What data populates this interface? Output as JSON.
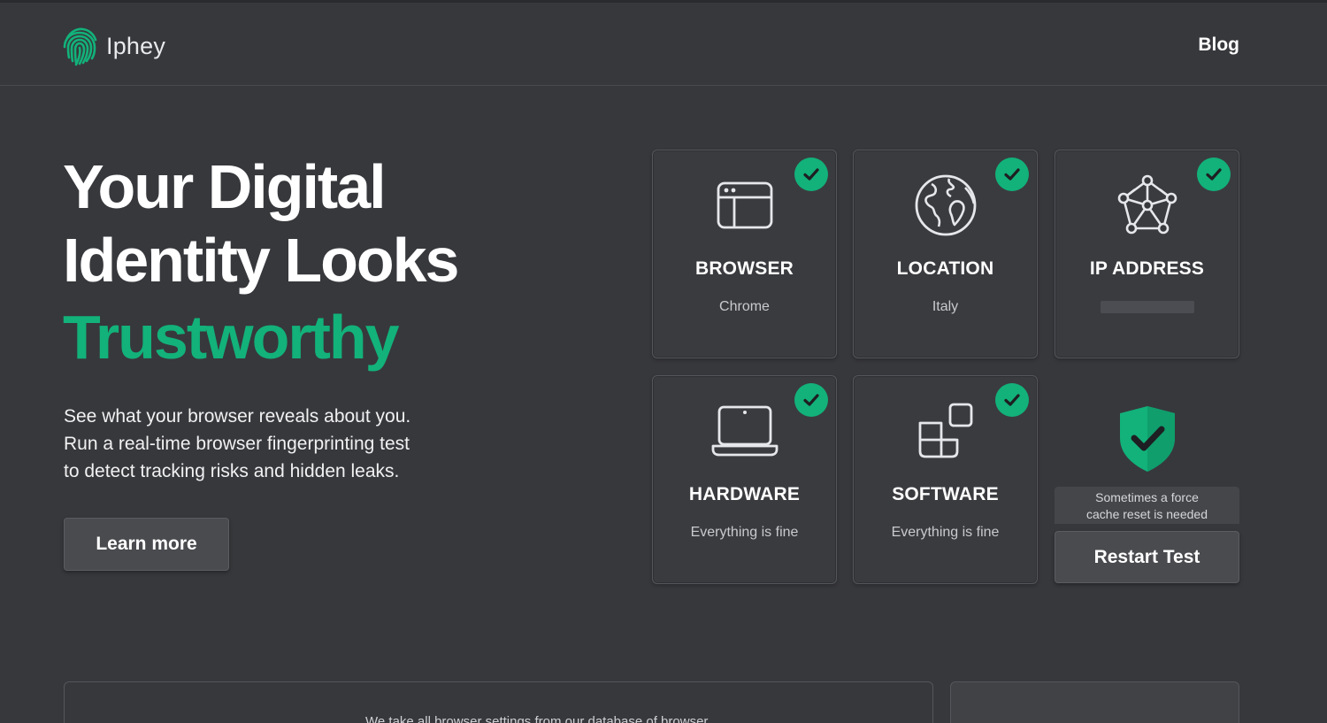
{
  "header": {
    "brand": "Iphey",
    "logo_icon": "fingerprint-icon",
    "nav_blog": "Blog"
  },
  "hero": {
    "title_line1": "Your Digital",
    "title_line2": "Identity Looks",
    "title_accent": "Trustworthy",
    "description_line1": "See what your browser reveals about you.",
    "description_line2": "Run a real-time browser fingerprinting test",
    "description_line3": "to detect tracking risks and hidden leaks.",
    "learn_more": "Learn more"
  },
  "cards": {
    "browser": {
      "title": "BROWSER",
      "value": "Chrome",
      "icon": "browser-window-icon",
      "status": "ok"
    },
    "location": {
      "title": "LOCATION",
      "value": "Italy",
      "icon": "globe-icon",
      "status": "ok"
    },
    "ip_address": {
      "title": "IP ADDRESS",
      "value": "",
      "icon": "network-icon",
      "status": "ok"
    },
    "hardware": {
      "title": "HARDWARE",
      "value": "Everything is fine",
      "icon": "laptop-icon",
      "status": "ok"
    },
    "software": {
      "title": "SOFTWARE",
      "value": "Everything is fine",
      "icon": "apps-icon",
      "status": "ok"
    }
  },
  "summary": {
    "icon": "shield-check-icon",
    "note_line1": "Sometimes a force",
    "note_line2": "cache reset is needed",
    "restart": "Restart Test"
  },
  "bottom": {
    "partial_text": "We take all browser settings from our database of browser"
  },
  "colors": {
    "background": "#37383c",
    "accent": "#12b27a",
    "card": "#3a3b3f",
    "button": "#4a4b4f"
  }
}
